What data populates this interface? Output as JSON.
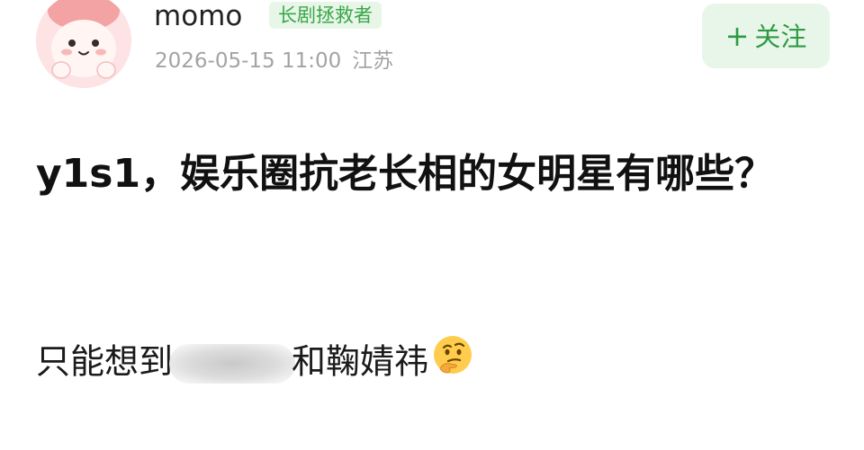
{
  "author": {
    "name": "momo",
    "badge": "长剧拯救者",
    "timestamp": "2026-05-15 11:00",
    "location": "江苏",
    "avatar_icon": "cartoon-peach-avatar-icon"
  },
  "follow": {
    "plus": "+",
    "label": "关注"
  },
  "post": {
    "title": "y1s1，娱乐圈抗老长相的女明星有哪些？",
    "body_before": "只能想到",
    "body_after": "和鞠婧祎",
    "emoji_icon": "thinking-face-icon"
  },
  "colors": {
    "accent_green": "#2f9a44",
    "badge_bg": "#e7f6e7",
    "meta_gray": "#a3a3a3"
  }
}
